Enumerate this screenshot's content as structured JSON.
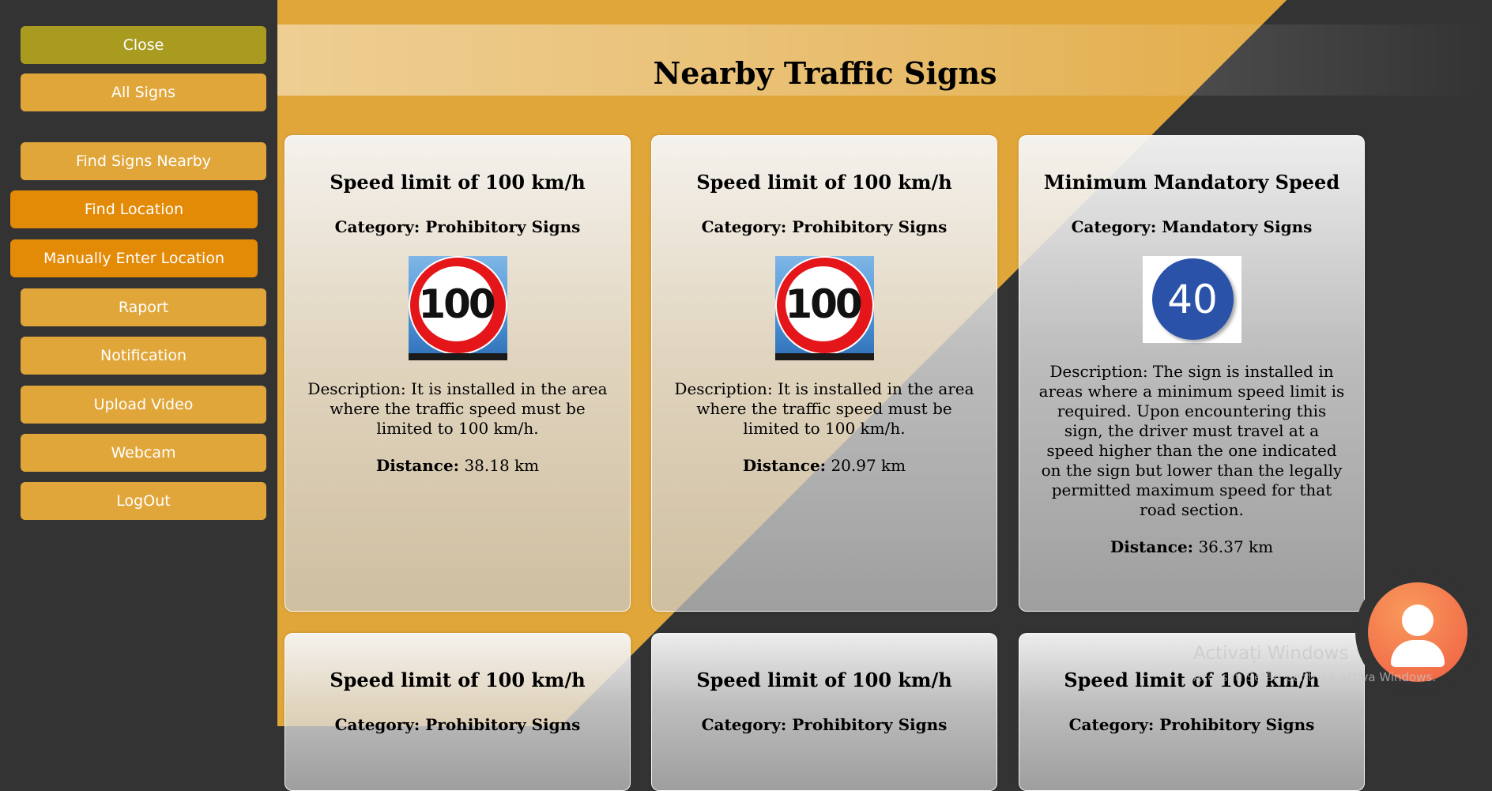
{
  "sidebar": {
    "buttons": [
      {
        "label": "Close"
      },
      {
        "label": "All Signs"
      },
      {
        "label": "Find Signs Nearby"
      },
      {
        "label": "Find Location"
      },
      {
        "label": "Manually Enter Location"
      },
      {
        "label": "Raport"
      },
      {
        "label": "Notification"
      },
      {
        "label": "Upload Video"
      },
      {
        "label": "Webcam"
      },
      {
        "label": "LogOut"
      }
    ]
  },
  "page": {
    "title": "Nearby Traffic Signs"
  },
  "cards": [
    {
      "title": "Speed limit of 100 km/h",
      "category": "Category: Prohibitory Signs",
      "sign_value": "100",
      "description": "Description: It is installed in the area where the traffic speed must be limited to 100 km/h.",
      "distance_label": "Distance:",
      "distance_value": "38.18 km"
    },
    {
      "title": "Speed limit of 100 km/h",
      "category": "Category: Prohibitory Signs",
      "sign_value": "100",
      "description": "Description: It is installed in the area where the traffic speed must be limited to 100 km/h.",
      "distance_label": "Distance:",
      "distance_value": "20.97 km"
    },
    {
      "title": "Minimum Mandatory Speed",
      "category": "Category: Mandatory Signs",
      "sign_value": "40",
      "description": "Description: The sign is installed in areas where a minimum speed limit is required. Upon encountering this sign, the driver must travel at a speed higher than the one indicated on the sign but lower than the legally permitted maximum speed for that road section.",
      "distance_label": "Distance:",
      "distance_value": "36.37 km"
    },
    {
      "title": "Speed limit of 100 km/h",
      "category": "Category: Prohibitory Signs"
    },
    {
      "title": "Speed limit of 100 km/h",
      "category": "Category: Prohibitory Signs"
    },
    {
      "title": "Speed limit of 100 km/h",
      "category": "Category: Prohibitory Signs"
    }
  ],
  "watermark": {
    "title": "Activați Windows",
    "subtitle": "Accesați Setări pentru a activa Windows."
  },
  "colors": {
    "accent": "#e0a63a",
    "active": "#e38a07",
    "close": "#a99b1f",
    "dark_bg": "#333333"
  },
  "icons": {
    "avatar": "user-avatar-icon"
  }
}
